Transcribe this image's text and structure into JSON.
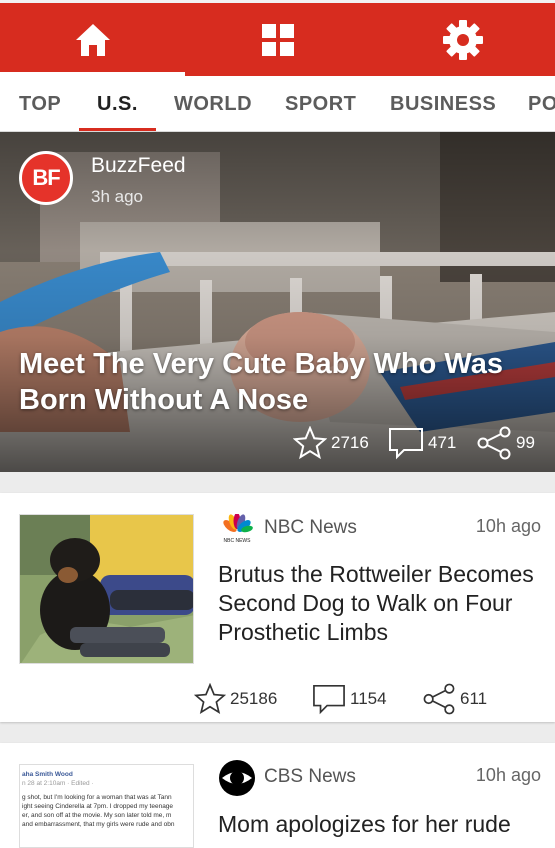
{
  "nav": {
    "items": [
      {
        "name": "home",
        "icon": "home-icon"
      },
      {
        "name": "grid",
        "icon": "grid-icon"
      },
      {
        "name": "settings",
        "icon": "gear-icon"
      }
    ],
    "active": "home",
    "color": "#d72c1f"
  },
  "tabs": {
    "items": [
      "TOP",
      "U.S.",
      "WORLD",
      "SPORT",
      "BUSINESS",
      "PO"
    ],
    "active": "U.S."
  },
  "hero": {
    "logo": "BF",
    "source": "BuzzFeed",
    "time": "3h ago",
    "headline": "Meet The Very Cute Baby Who Was Born Without A Nose",
    "likes": "2716",
    "comments": "471",
    "shares": "99"
  },
  "articles": [
    {
      "source": "NBC News",
      "logo_text": "NBC NEWS",
      "time": "10h ago",
      "title": "Brutus the Rottweiler Becomes Second Dog to Walk on Four Prosthetic Limbs",
      "likes": "25186",
      "comments": "1154",
      "shares": "611"
    },
    {
      "source": "CBS News",
      "time": "10h ago",
      "title": "Mom apologizes for her rude",
      "thumb_name": "aha Smith Wood",
      "thumb_meta": "n 28 at 2:10am · Edited ·",
      "thumb_lines": [
        "g shot, but I'm looking for a woman that was at Tann",
        "ight seeing Cinderella at 7pm. I dropped my teenage",
        "er, and son off at the movie. My son later told me, m",
        "and embarrassment, that my girls were rude and obn"
      ]
    }
  ]
}
